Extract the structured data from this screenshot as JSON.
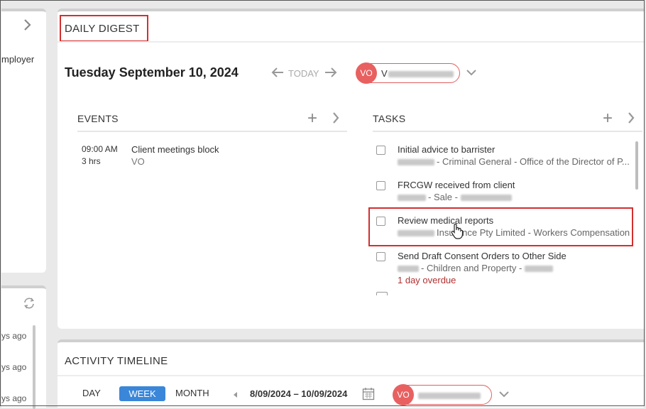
{
  "left_panel": {
    "top_text": "mployer",
    "ago": [
      "ys ago",
      "ys ago",
      "ys ago"
    ]
  },
  "digest": {
    "title": "DAILY DIGEST",
    "date": "Tuesday September 10, 2024",
    "today_label": "TODAY",
    "user_initials": "VO",
    "user_name_prefix": "V",
    "events": {
      "header": "EVENTS",
      "items": [
        {
          "time": "09:00 AM",
          "duration": "3 hrs",
          "title": "Client meetings block",
          "owner": "VO"
        }
      ]
    },
    "tasks": {
      "header": "TASKS",
      "items": [
        {
          "title": "Initial advice to barrister",
          "sub": "- Criminal General - Office of the Director of P...",
          "overdue": ""
        },
        {
          "title": "FRCGW received from client",
          "sub": "- Sale -",
          "overdue": ""
        },
        {
          "title": "Review medical reports",
          "sub": "Insurance Pty Limited - Workers Compensation",
          "overdue": ""
        },
        {
          "title": "Send Draft Consent Orders to Other Side",
          "sub": "- Children and Property -",
          "overdue": "1 day overdue"
        }
      ]
    }
  },
  "timeline": {
    "title": "ACTIVITY TIMELINE",
    "tabs": {
      "day": "DAY",
      "week": "WEEK",
      "month": "MONTH"
    },
    "range": "8/09/2024 – 10/09/2024",
    "user_initials": "VO"
  },
  "colors": {
    "accent": "#3a86d9",
    "avatar": "#e86060",
    "highlight": "#d32f2f",
    "overdue": "#b03030"
  }
}
